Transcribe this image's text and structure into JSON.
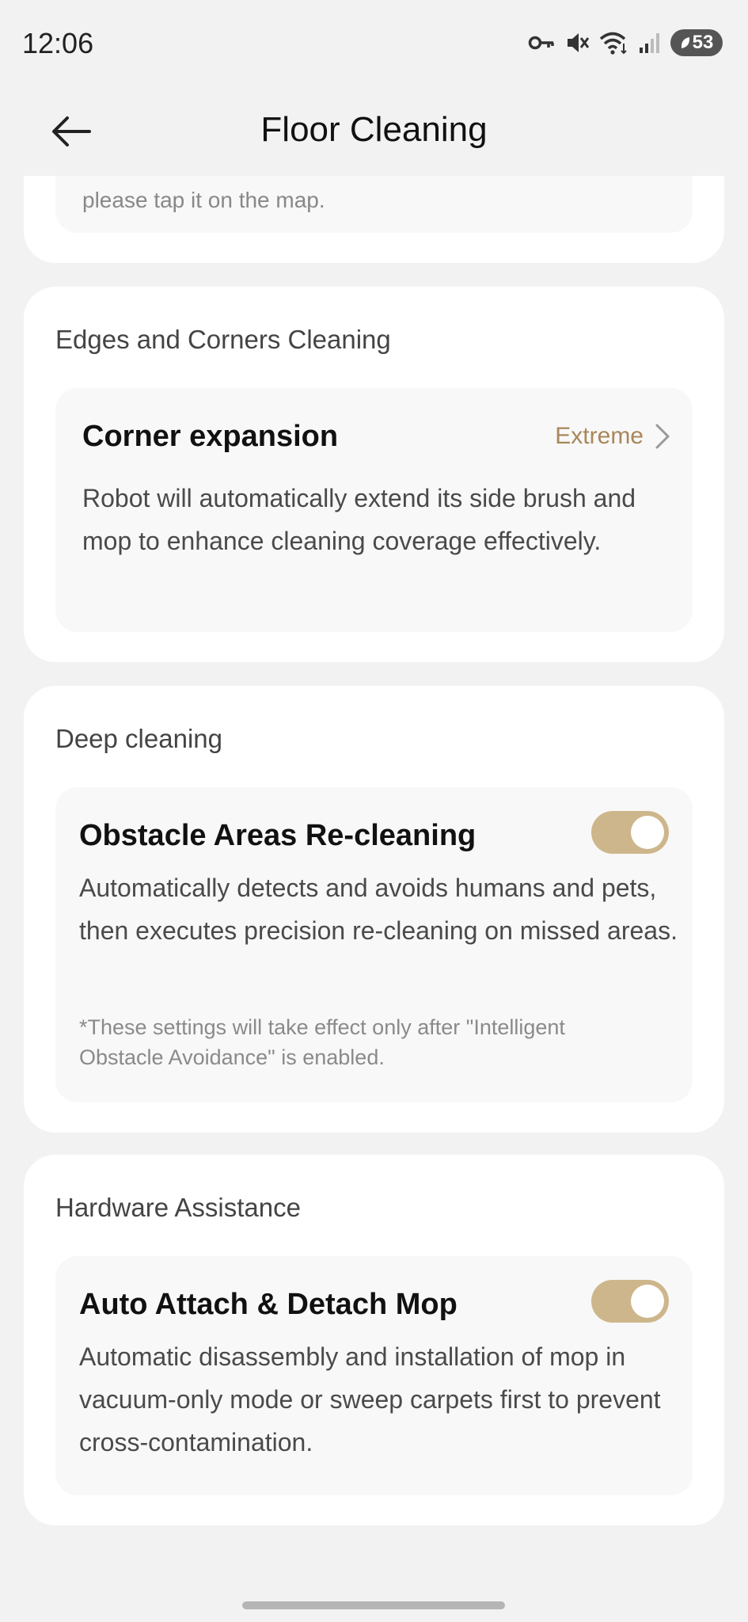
{
  "status": {
    "time": "12:06",
    "battery": "53"
  },
  "header": {
    "title": "Floor Cleaning"
  },
  "top_card": {
    "desc_tail": "please tap it on the map."
  },
  "edges": {
    "section_title": "Edges and Corners Cleaning",
    "item_title": "Corner expansion",
    "value": "Extreme",
    "desc": "Robot will automatically extend its side brush and mop to enhance cleaning coverage effectively."
  },
  "deep": {
    "section_title": "Deep cleaning",
    "item_title": "Obstacle Areas Re-cleaning",
    "toggle_on": true,
    "desc": "Automatically detects and avoids humans and pets, then executes precision re-cleaning on missed areas.",
    "note": "*These settings will take effect only after \"Intelligent Obstacle Avoidance\" is enabled."
  },
  "hardware": {
    "section_title": "Hardware Assistance",
    "item_title": "Auto Attach & Detach Mop",
    "toggle_on": true,
    "desc": "Automatic disassembly and installation of mop in vacuum-only mode or sweep carpets first to prevent cross-contamination."
  },
  "colors": {
    "accent_text": "#a8875a",
    "toggle_on": "#cdb68b",
    "card": "#ffffff",
    "inner_card": "#f8f8f8",
    "background": "#f2f2f2"
  }
}
